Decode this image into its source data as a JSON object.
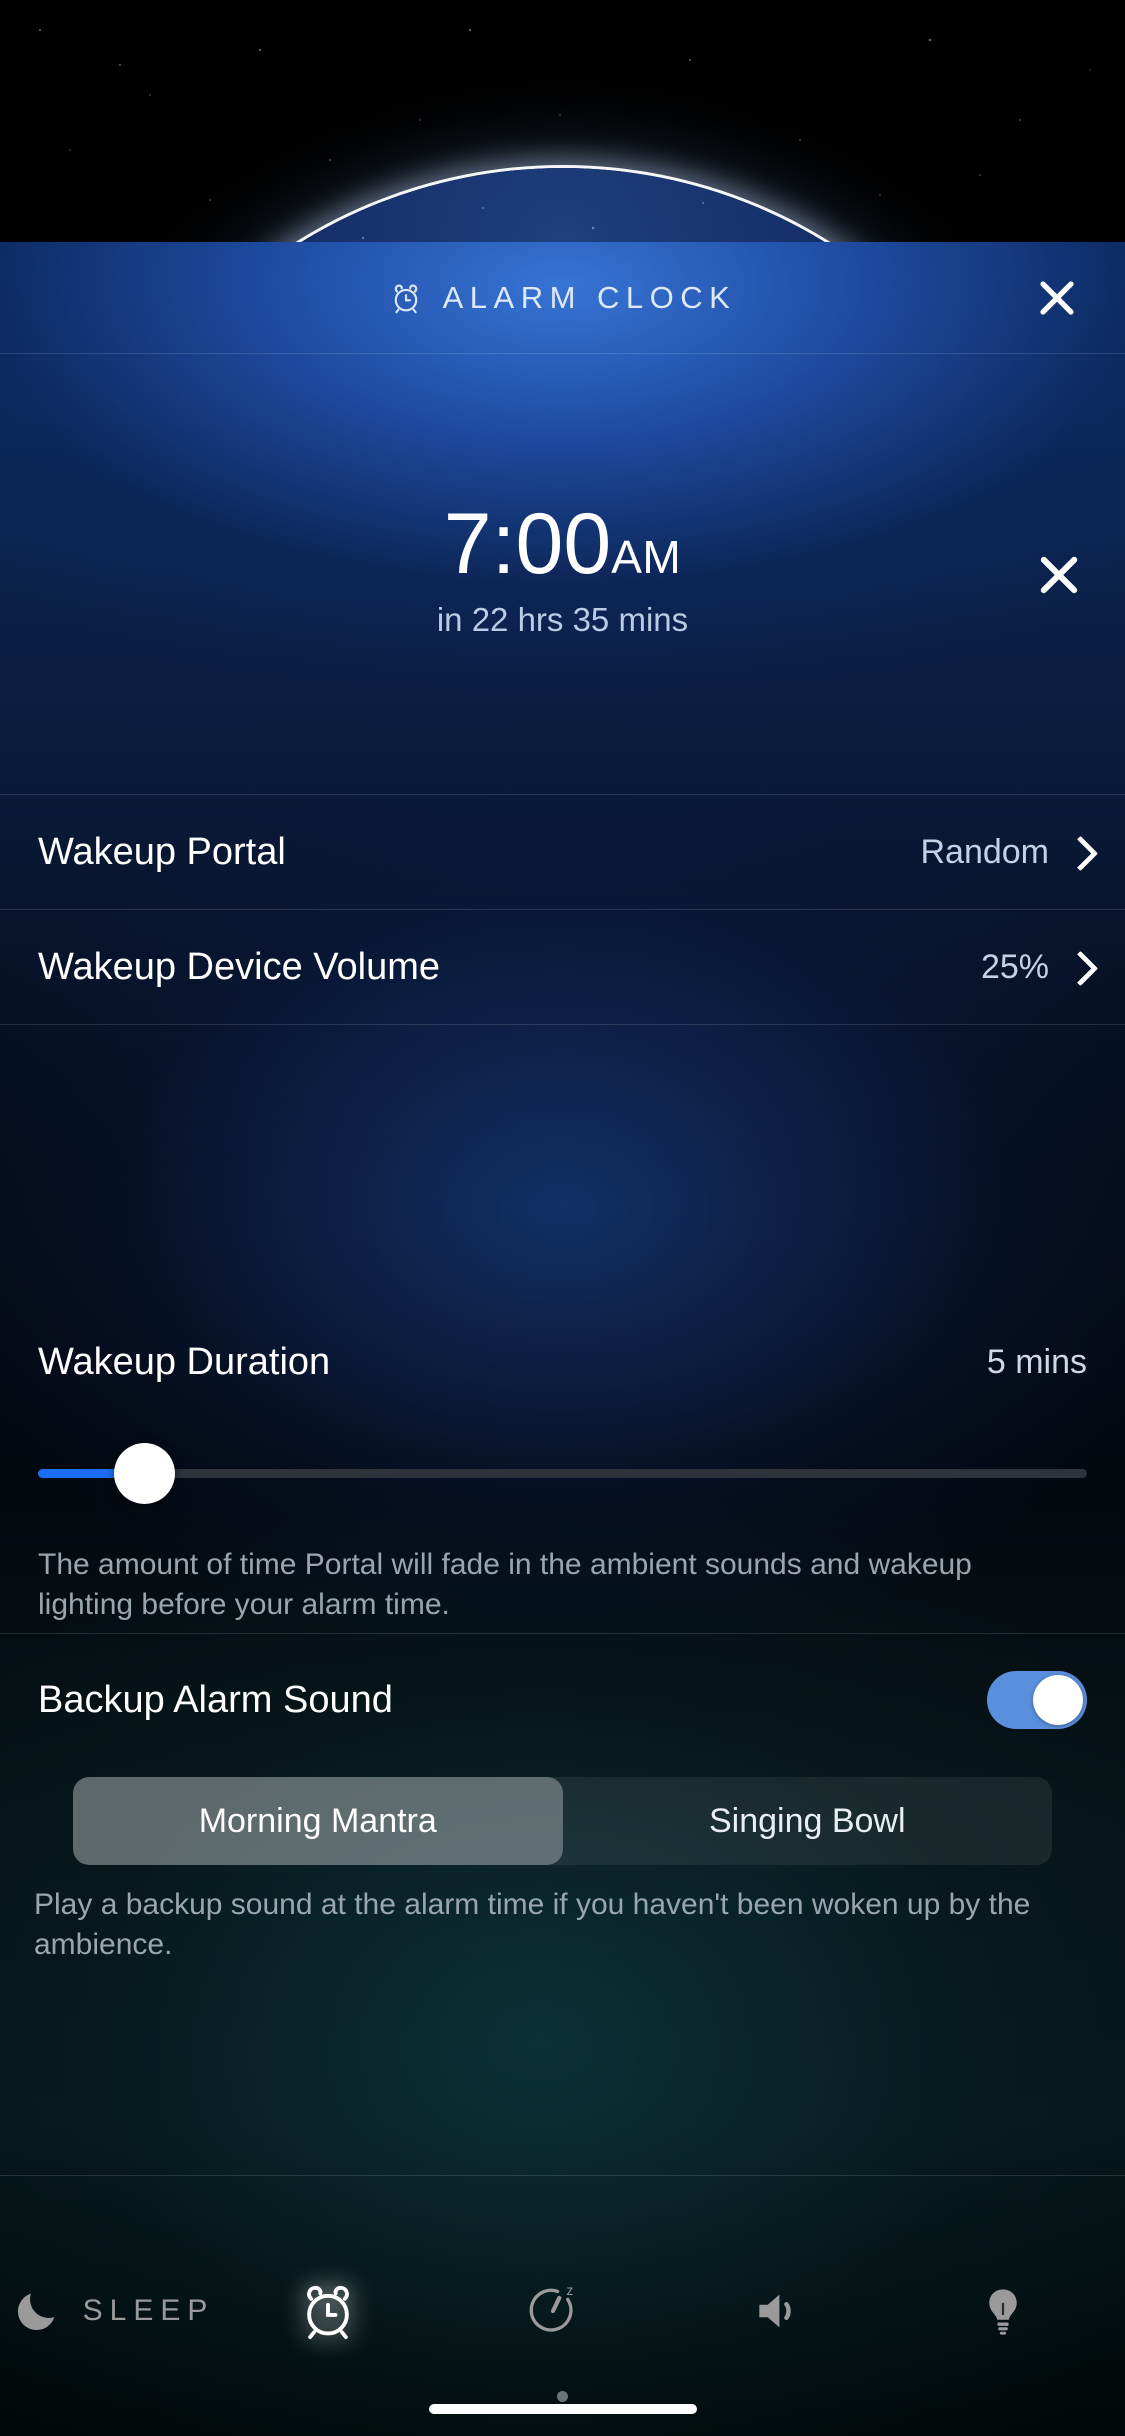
{
  "header": {
    "title": "ALARM CLOCK",
    "icon": "alarm-clock-icon",
    "close_icon": "close-icon"
  },
  "alarm": {
    "time": "7:00",
    "meridiem": "AM",
    "countdown": "in 22 hrs 35 mins",
    "delete_icon": "close-icon"
  },
  "rows": [
    {
      "label": "Wakeup Portal",
      "value": "Random",
      "chevron": "chevron-right-icon"
    },
    {
      "label": "Wakeup Device Volume",
      "value": "25%",
      "chevron": "chevron-right-icon"
    }
  ],
  "duration": {
    "label": "Wakeup Duration",
    "value": "5 mins",
    "slider_percent": 5,
    "note": "The amount of time Portal will fade in the ambient sounds and wakeup lighting before your alarm time."
  },
  "backup": {
    "label": "Backup Alarm Sound",
    "enabled": true,
    "options": [
      "Morning Mantra",
      "Singing Bowl"
    ],
    "selected": "Morning Mantra",
    "note": "Play a backup sound at the alarm time if you haven't been woken up by the ambience."
  },
  "tabbar": {
    "items": [
      {
        "name": "sleep",
        "label": "SLEEP",
        "icon": "moon-icon",
        "active": false
      },
      {
        "name": "alarm",
        "label": "",
        "icon": "alarm-clock-icon",
        "active": true
      },
      {
        "name": "sleep-timer",
        "label": "",
        "icon": "sleep-timer-icon",
        "active": false
      },
      {
        "name": "volume",
        "label": "",
        "icon": "speaker-icon",
        "active": false
      },
      {
        "name": "light",
        "label": "",
        "icon": "lightbulb-icon",
        "active": false
      }
    ]
  },
  "colors": {
    "accent_blue": "#1b6ef3",
    "toggle_on": "#5a8fdd",
    "panel_top": "#2a63c9"
  }
}
